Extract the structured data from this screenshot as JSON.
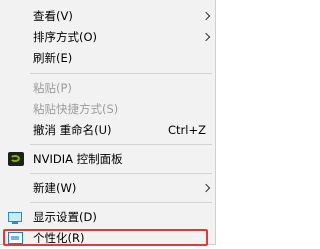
{
  "menu": {
    "items": [
      {
        "label": "查看(V)"
      },
      {
        "label": "排序方式(O)"
      },
      {
        "label": "刷新(E)"
      },
      {
        "label": "粘贴(P)"
      },
      {
        "label": "粘贴快捷方式(S)"
      },
      {
        "label": "撤消 重命名(U)",
        "shortcut": "Ctrl+Z"
      },
      {
        "label": "NVIDIA 控制面板",
        "icon": "nvidia-icon"
      },
      {
        "label": "新建(W)"
      },
      {
        "label": "显示设置(D)",
        "icon": "display-icon"
      },
      {
        "label": "个性化(R)",
        "icon": "personal-icon"
      }
    ]
  },
  "colors": {
    "menu_background": "#f2f2f2",
    "disabled_text": "#9c9c9c",
    "highlight_border": "#e23a3a"
  }
}
